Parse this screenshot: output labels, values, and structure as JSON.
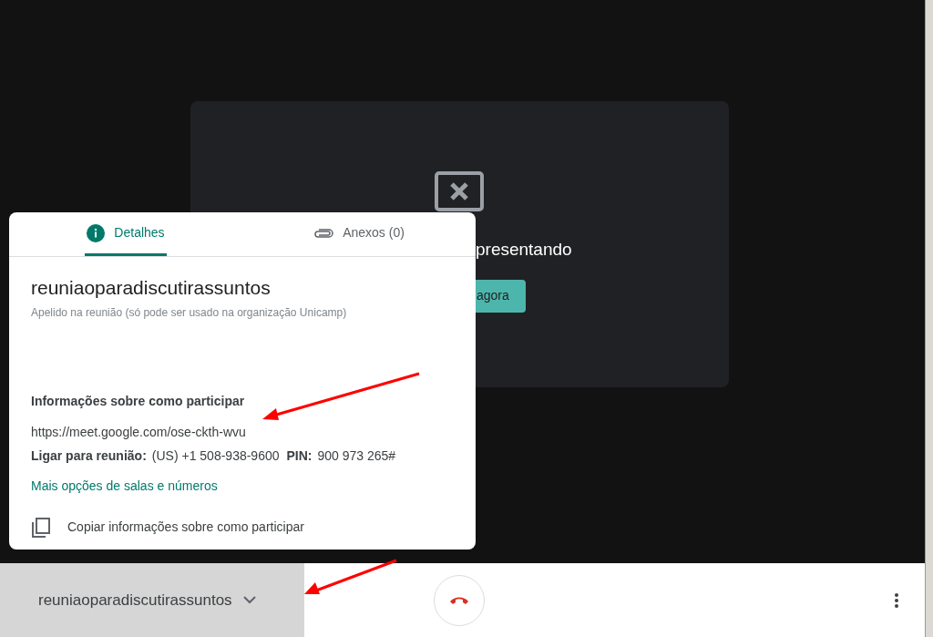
{
  "stage": {
    "message": "presentando",
    "button": "agora"
  },
  "popup": {
    "tabs": [
      {
        "label": "Detalhes",
        "kind": "info",
        "selected": true
      },
      {
        "label": "Anexos (0)",
        "kind": "attachment",
        "selected": false
      }
    ],
    "meeting_name": "reuniaoparadiscutirassuntos",
    "nickname_note": "Apelido na reunião (só pode ser usado na organização Unicamp)",
    "join_heading": "Informações sobre como participar",
    "url": "https://meet.google.com/ose-ckth-wvu",
    "dial_label": "Ligar para reunião:",
    "dial_number": "(US) +1 508-938-9600",
    "pin_label": "PIN:",
    "pin": "900 973 265#",
    "more_link": "Mais opções de salas e números",
    "copy_action": "Copiar informações sobre como participar"
  },
  "bottom_bar": {
    "meeting_name": "reuniaoparadiscutirassuntos"
  }
}
